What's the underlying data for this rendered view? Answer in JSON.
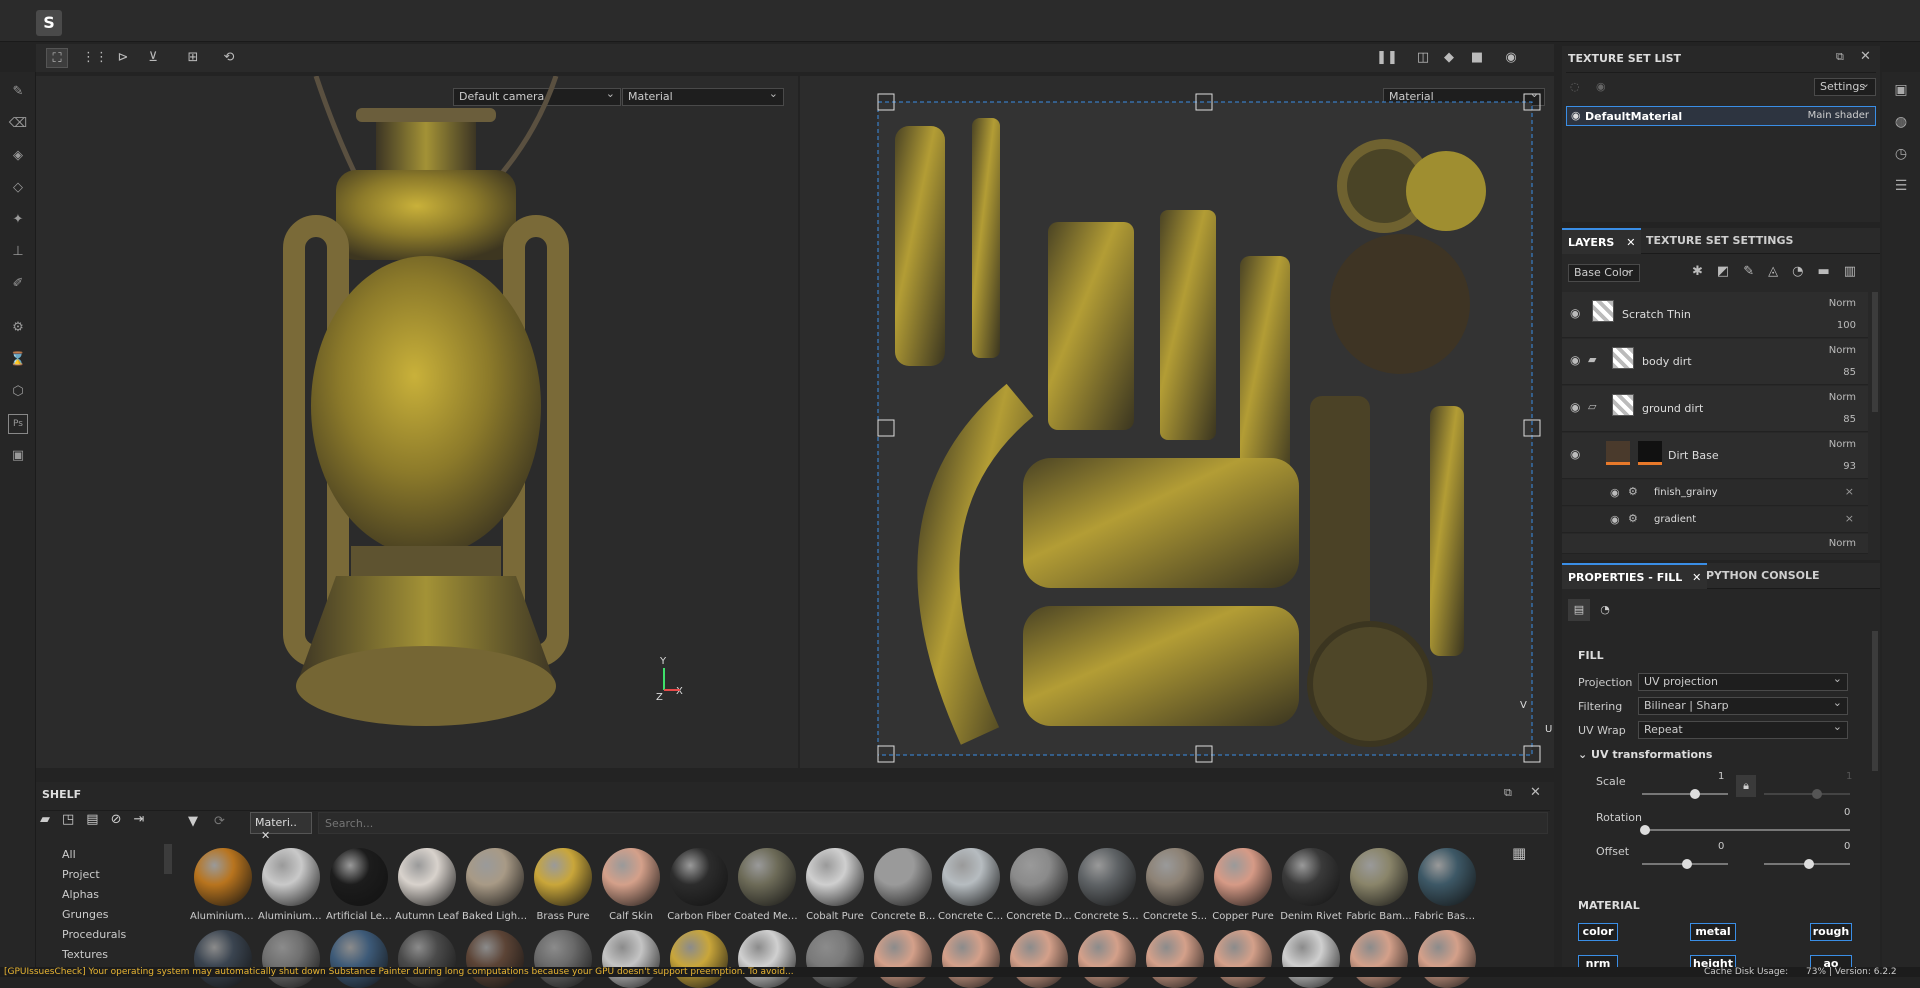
{
  "app": {
    "logo_glyph": "S"
  },
  "toolbar": {
    "left_icons": [
      "select-icon",
      "grid-icon",
      "mirror-x-icon",
      "mirror-y-icon",
      "add-icon",
      "history-icon"
    ],
    "right_icons": [
      "pause-icon",
      "split-view-icon",
      "cube-icon",
      "camera-icon",
      "screenshot-icon"
    ]
  },
  "viewport3d": {
    "camera_select": "Default camera",
    "mode_select": "Material"
  },
  "viewport2d": {
    "mode_select": "Material",
    "axis_v": "V",
    "axis_u": "U"
  },
  "axis3d": {
    "y": "Y",
    "x": "X",
    "z": "Z"
  },
  "texture_set_list": {
    "title": "TEXTURE SET LIST",
    "settings_label": "Settings",
    "material_name": "DefaultMaterial",
    "shader": "Main shader"
  },
  "layers_panel": {
    "tab_layers": "LAYERS",
    "tab_texture_set_settings": "TEXTURE SET SETTINGS",
    "channel_select": "Base Color",
    "layers": [
      {
        "name": "Scratch Thin",
        "blend": "Norm",
        "opacity": "100"
      },
      {
        "name": "body dirt",
        "blend": "Norm",
        "opacity": "85"
      },
      {
        "name": "ground dirt",
        "blend": "Norm",
        "opacity": "85"
      },
      {
        "name": "Dirt Base",
        "blend": "Norm",
        "opacity": "93"
      }
    ],
    "effects": [
      {
        "name": "finish_grainy"
      },
      {
        "name": "gradient"
      }
    ],
    "last_blend": "Norm"
  },
  "properties": {
    "tab_fill": "PROPERTIES - FILL",
    "tab_python": "PYTHON CONSOLE",
    "section_fill": "FILL",
    "projection_label": "Projection",
    "projection_value": "UV projection",
    "filtering_label": "Filtering",
    "filtering_value": "Bilinear | Sharp",
    "uvwrap_label": "UV Wrap",
    "uvwrap_value": "Repeat",
    "uv_transform_label": "UV transformations",
    "scale_label": "Scale",
    "scale_value": "1",
    "scale_value2": "1",
    "rotation_label": "Rotation",
    "rotation_value": "0",
    "offset_label": "Offset",
    "offset_value1": "0",
    "offset_value2": "0",
    "section_material": "MATERIAL",
    "channels": [
      "color",
      "metal",
      "rough"
    ],
    "channels_row2": [
      "nrm",
      "height",
      "ao"
    ]
  },
  "shelf": {
    "title": "SHELF",
    "filter_tag": "Materi..",
    "search_placeholder": "Search...",
    "categories": [
      "All",
      "Project",
      "Alphas",
      "Grunges",
      "Procedurals",
      "Textures"
    ],
    "materials": [
      {
        "name": "Aluminium ...",
        "color": "#b8741e"
      },
      {
        "name": "Aluminium ...",
        "color": "#c9c9c9"
      },
      {
        "name": "Artificial Lea...",
        "color": "#1c1c1c"
      },
      {
        "name": "Autumn Leaf",
        "color": "#d8d2cc"
      },
      {
        "name": "Baked Light...",
        "color": "#a89a86"
      },
      {
        "name": "Brass Pure",
        "color": "#c9a63a"
      },
      {
        "name": "Calf Skin",
        "color": "#d4a08a"
      },
      {
        "name": "Carbon Fiber",
        "color": "#2c2c2c"
      },
      {
        "name": "Coated Metal",
        "color": "#6d6b58"
      },
      {
        "name": "Cobalt Pure",
        "color": "#cfcfcf"
      },
      {
        "name": "Concrete B...",
        "color": "#9a9a9a"
      },
      {
        "name": "Concrete Cl...",
        "color": "#b6bcc0"
      },
      {
        "name": "Concrete D...",
        "color": "#8a8a8a"
      },
      {
        "name": "Concrete Si...",
        "color": "#5f6366"
      },
      {
        "name": "Concrete S...",
        "color": "#8d8275"
      },
      {
        "name": "Copper Pure",
        "color": "#d69a86"
      },
      {
        "name": "Denim Rivet",
        "color": "#3a3a3a"
      },
      {
        "name": "Fabric Bam...",
        "color": "#8a856a"
      },
      {
        "name": "Fabric Base...",
        "color": "#3d5866"
      }
    ],
    "row2_colors": [
      "#3a4450",
      "#707070",
      "#3d5a78",
      "#4a4a4a",
      "#5c4436",
      "#6a6a6a",
      "#c4c4c4",
      "#c9a63a",
      "#d0d0d0",
      "#7a7a7a",
      "#d4a08a",
      "#d4a08a",
      "#d4a08a",
      "#d4a08a",
      "#d4a08a",
      "#d4a08a",
      "#cfcfcf",
      "#d4a08a",
      "#d4a08a"
    ]
  },
  "statusbar": {
    "message": "[GPUIssuesCheck] Your operating system may automatically shut down Substance Painter during long computations because your GPU doesn't support preemption. To avoid...",
    "disk_usage": "Cache Disk Usage:",
    "disk_value": "73% | Version: 6.2.2"
  }
}
